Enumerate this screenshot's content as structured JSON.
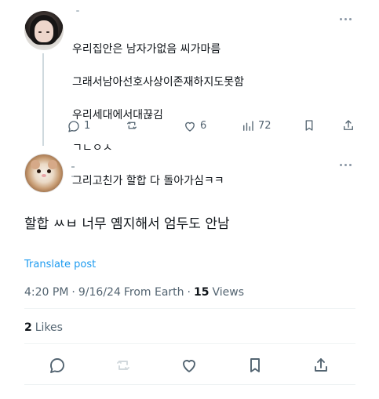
{
  "first_post": {
    "lines": [
      "우리집안은 남자가없음 씨가마름",
      "그래서남아선호사상이존재하지도못함",
      "우리세대에서대끊김",
      "ㄱㄴㅇㅅ",
      "그리고친가 할합 다 돌아가심ㅋㅋ"
    ],
    "reply_count": "1",
    "like_count": "6",
    "view_count": "72",
    "icons": {
      "reply": "reply-icon",
      "repost": "repost-icon",
      "like": "like-icon",
      "views": "views-icon",
      "bookmark": "bookmark-icon",
      "share": "share-icon"
    }
  },
  "reply_post": {
    "text": "할합 ㅆㅂ 너무 옘지해서 엄두도 안남",
    "translate_label": "Translate post",
    "time": "4:20 PM",
    "separator1": "·",
    "date": "9/16/24",
    "location": "From Earth",
    "separator2": "·",
    "views_count": "15",
    "views_label": "Views",
    "likes_count": "2",
    "likes_label": "Likes"
  },
  "colors": {
    "text_primary": "#0f1419",
    "text_secondary": "#536471",
    "link": "#1d9bf0",
    "divider": "#eff3f4",
    "thread_line": "#cfd9de"
  }
}
